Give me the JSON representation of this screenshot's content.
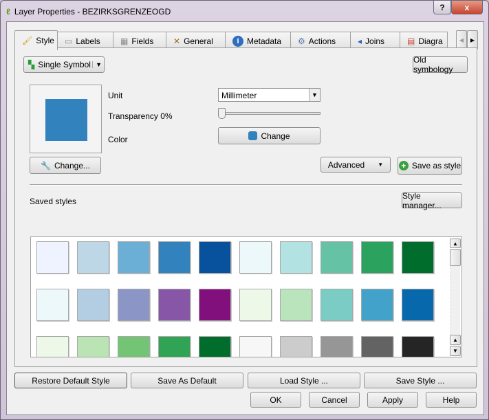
{
  "window": {
    "title": "Layer Properties - BEZIRKSGRENZEOGD",
    "help": "?",
    "close": "x"
  },
  "tabs": [
    {
      "label": "Style",
      "icon": "paintbrush-icon"
    },
    {
      "label": "Labels",
      "icon": "label-icon"
    },
    {
      "label": "Fields",
      "icon": "table-icon"
    },
    {
      "label": "General",
      "icon": "tools-icon"
    },
    {
      "label": "Metadata",
      "icon": "info-icon"
    },
    {
      "label": "Actions",
      "icon": "gears-icon"
    },
    {
      "label": "Joins",
      "icon": "join-icon"
    },
    {
      "label": "Diagra",
      "icon": "diagram-icon"
    }
  ],
  "style": {
    "renderer": "Single Symbol",
    "old_symbology": "Old symbology",
    "symbol_color": "#3182bd",
    "unit_label": "Unit",
    "unit_value": "Millimeter",
    "transparency_label": "Transparency 0%",
    "transparency": 0,
    "color_label": "Color",
    "color_change": "Change",
    "change_button": "Change...",
    "advanced": "Advanced",
    "save_as_style": "Save as style",
    "saved_styles_label": "Saved styles",
    "style_manager": "Style manager...",
    "swatches": [
      [
        "#eff3ff",
        "#bdd7e7",
        "#6baed6",
        "#3182bd",
        "#08519c",
        "#edf8fb",
        "#b2e2e2",
        "#66c2a4",
        "#2ca25f",
        "#006d2c"
      ],
      [
        "#edf8fb",
        "#b3cde3",
        "#8c96c6",
        "#8856a7",
        "#810f7c",
        "#edf8e9",
        "#bae4bc",
        "#7bccc4",
        "#43a2ca",
        "#0868ac"
      ],
      [
        "#edf8e9",
        "#bae4b3",
        "#74c476",
        "#31a354",
        "#006d2c",
        "#f7f7f7",
        "#cccccc",
        "#969696",
        "#636363",
        "#252525"
      ]
    ]
  },
  "buttons": {
    "restore": "Restore Default Style",
    "save_default": "Save As Default",
    "load_style": "Load Style ...",
    "save_style": "Save Style ...",
    "ok": "OK",
    "cancel": "Cancel",
    "apply": "Apply",
    "help": "Help"
  }
}
